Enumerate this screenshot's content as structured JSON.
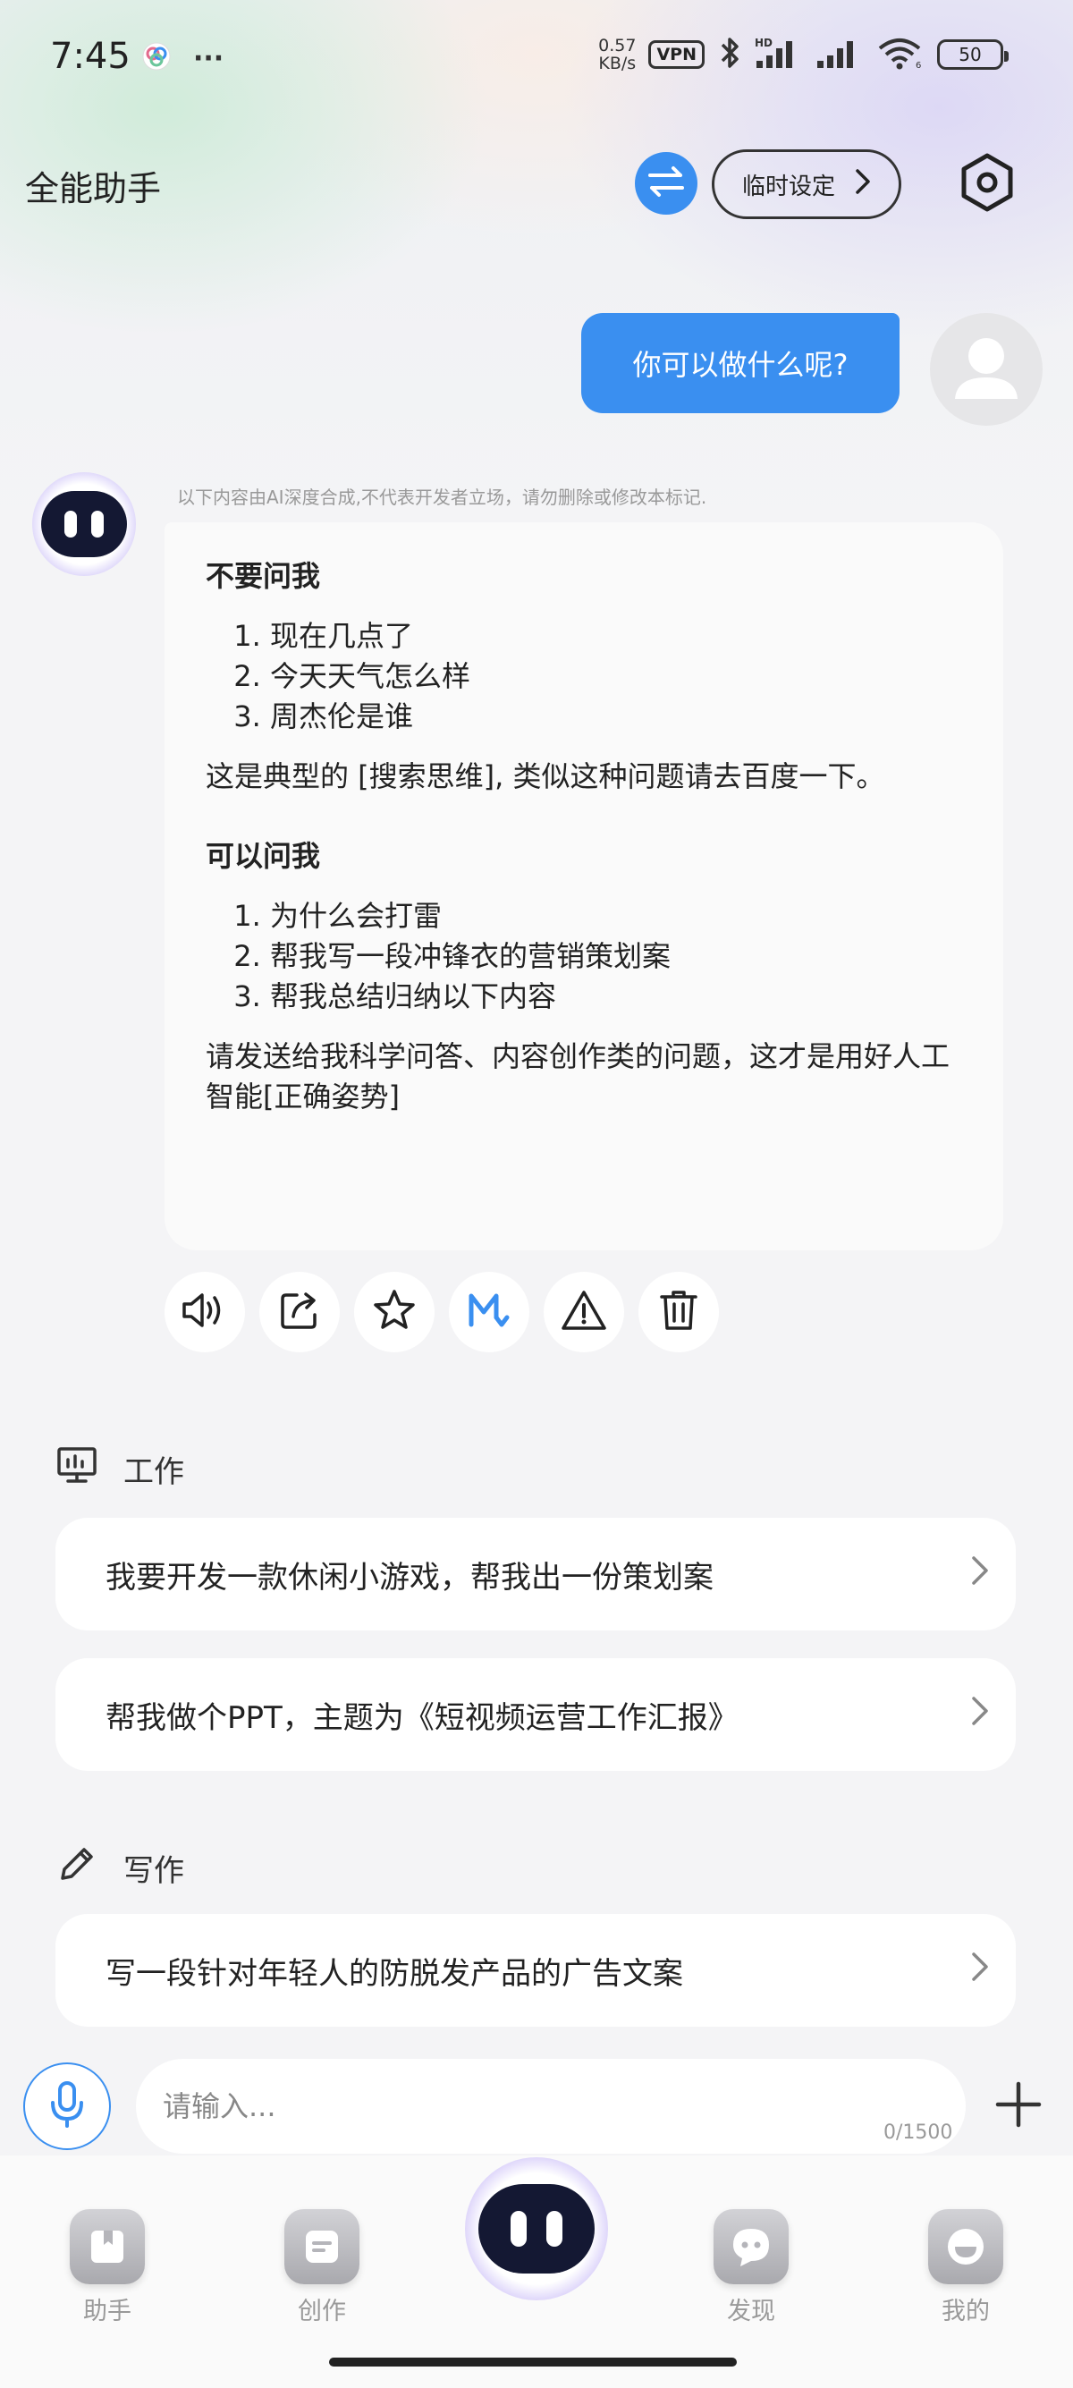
{
  "status_bar": {
    "time": "7:45",
    "more": "···",
    "net_speed_value": "0.57",
    "net_speed_unit": "KB/s",
    "vpn": "VPN",
    "battery": "50"
  },
  "header": {
    "title": "全能助手",
    "temp_setting_label": "临时设定",
    "icons": [
      "swap-icon",
      "chevron-right-icon",
      "hexagon-settings-icon"
    ]
  },
  "chat": {
    "user_message": "你可以做什么呢?",
    "disclaimer": "以下内容由AI深度合成,不代表开发者立场，请勿删除或修改本标记.",
    "bot_reply": {
      "heading_dont": "不要问我",
      "dont_items": [
        "现在几点了",
        "今天天气怎么样",
        "周杰伦是谁"
      ],
      "search_note": "这是典型的 [搜索思维], 类似这种问题请去百度一下。",
      "heading_do": "可以问我",
      "do_items": [
        "为什么会打雷",
        "帮我写一段冲锋衣的营销策划案",
        "帮我总结归纳以下内容"
      ],
      "closing": "请发送给我科学问答、内容创作类的问题，这才是用好人工智能[正确姿势]"
    },
    "actions": [
      "speaker-icon",
      "share-icon",
      "star-icon",
      "markdown-icon",
      "warning-icon",
      "trash-icon"
    ]
  },
  "suggestions": {
    "work": {
      "title": "工作",
      "items": [
        "我要开发一款休闲小游戏，帮我出一份策划案",
        "帮我做个PPT，主题为《短视频运营工作汇报》"
      ]
    },
    "writing": {
      "title": "写作",
      "items": [
        "写一段针对年轻人的防脱发产品的广告文案"
      ]
    }
  },
  "input": {
    "placeholder": "请输入...",
    "value": "",
    "counter": "0/1500"
  },
  "bottom_nav": {
    "items": [
      {
        "label": "助手",
        "icon": "bookmark-icon"
      },
      {
        "label": "创作",
        "icon": "document-icon"
      },
      {
        "label": "",
        "icon": "bot-icon"
      },
      {
        "label": "发现",
        "icon": "chat-bubble-icon"
      },
      {
        "label": "我的",
        "icon": "smiley-icon"
      }
    ]
  },
  "colors": {
    "accent": "#3a8ff0",
    "bot_dark": "#141833",
    "background": "#f4f4f6"
  }
}
